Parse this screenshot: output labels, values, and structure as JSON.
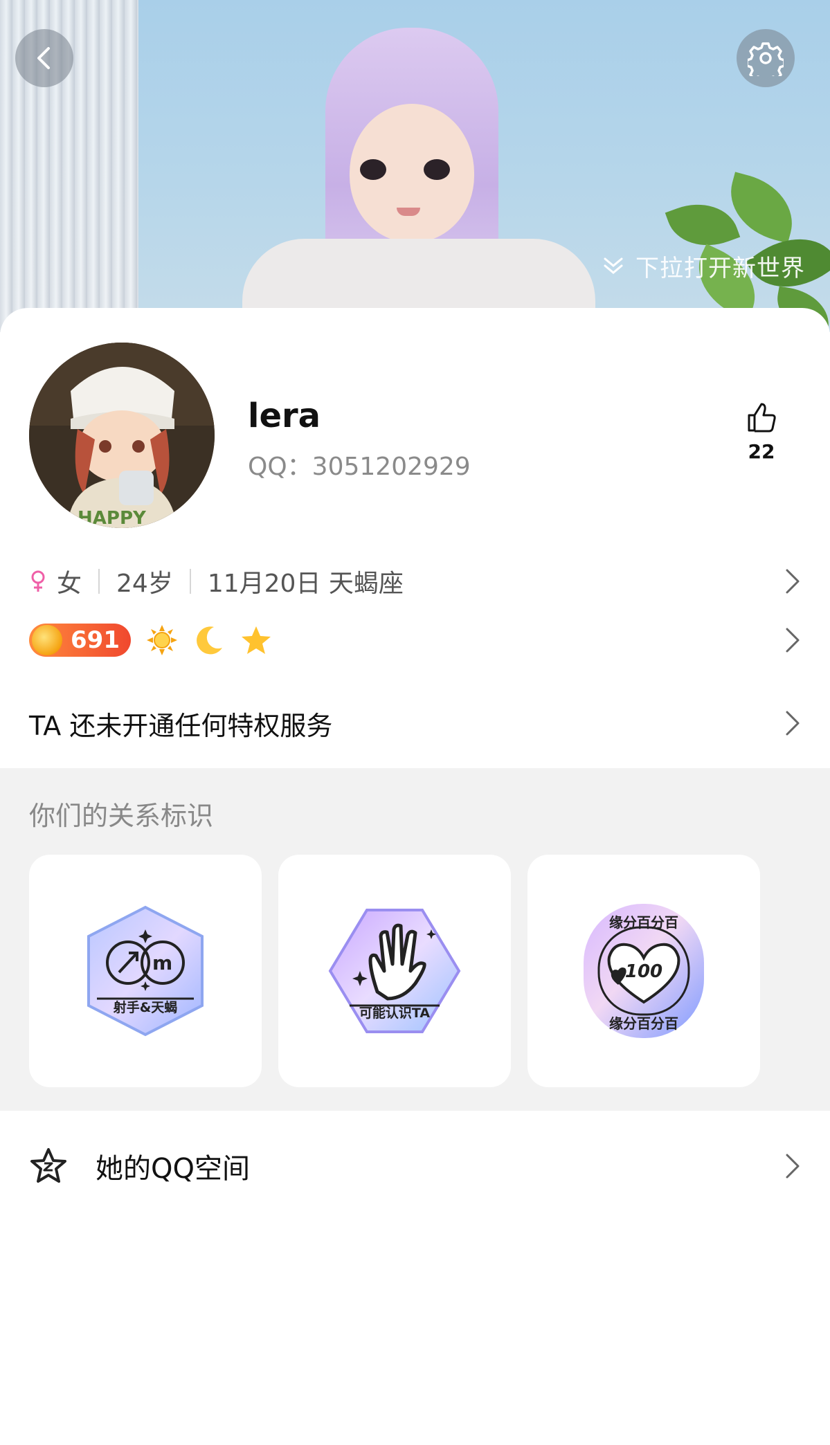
{
  "header": {
    "pull_hint": "下拉打开新世界",
    "back_icon": "chevron-left-icon",
    "settings_icon": "gear-icon"
  },
  "profile": {
    "nickname": "lera",
    "qq_label": "QQ：3051202929",
    "likes": "22",
    "like_icon": "thumbs-up-icon"
  },
  "info": {
    "gender": "女",
    "age": "24岁",
    "birthday": "11月20日 天蝎座"
  },
  "badges": {
    "level": "691"
  },
  "privilege": {
    "text": "TA 还未开通任何特权服务"
  },
  "relations": {
    "title": "你们的关系标识",
    "items": [
      {
        "label": "射手&天蝎",
        "icon": "zodiac-badge-icon"
      },
      {
        "label": "可能认识TA",
        "icon": "waving-hand-badge-icon"
      },
      {
        "label": "缘分百分百",
        "sub": "100",
        "icon": "heart-100-badge-icon"
      }
    ]
  },
  "qzone": {
    "label": "她的QQ空间",
    "icon": "star-outline-icon"
  },
  "colors": {
    "accent_orange": "#f0482e",
    "gender_pink": "#ef5fa7",
    "badge_gold": "#f5a311"
  }
}
